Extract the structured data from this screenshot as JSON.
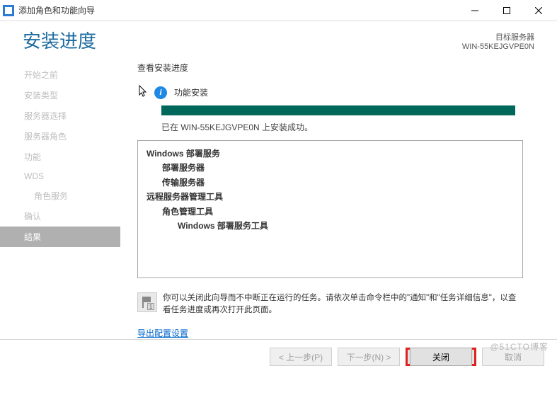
{
  "window": {
    "title": "添加角色和功能向导"
  },
  "header": {
    "title": "安装进度",
    "target_label": "目标服务器",
    "target_server": "WIN-55KEJGVPE0N"
  },
  "sidebar": {
    "items": [
      {
        "label": "开始之前"
      },
      {
        "label": "安装类型"
      },
      {
        "label": "服务器选择"
      },
      {
        "label": "服务器角色"
      },
      {
        "label": "功能"
      },
      {
        "label": "WDS"
      },
      {
        "label": "角色服务",
        "sub": true
      },
      {
        "label": "确认"
      },
      {
        "label": "结果",
        "active": true
      }
    ]
  },
  "progress": {
    "view_label": "查看安装进度",
    "status_title": "功能安装",
    "status_message": "已在 WIN-55KEJGVPE0N 上安装成功。"
  },
  "tree": [
    {
      "text": "Windows 部署服务",
      "bold": true,
      "indent": 0
    },
    {
      "text": "部署服务器",
      "bold": true,
      "indent": 1
    },
    {
      "text": "传输服务器",
      "bold": true,
      "indent": 1
    },
    {
      "text": "远程服务器管理工具",
      "bold": true,
      "indent": 0
    },
    {
      "text": "角色管理工具",
      "bold": true,
      "indent": 1
    },
    {
      "text": "Windows 部署服务工具",
      "bold": true,
      "indent": 2
    }
  ],
  "note": {
    "text": "你可以关闭此向导而不中断正在运行的任务。请依次单击命令栏中的\"通知\"和\"任务详细信息\"，以查看任务进度或再次打开此页面。"
  },
  "links": {
    "export": "导出配置设置"
  },
  "footer": {
    "previous": "< 上一步(P)",
    "next": "下一步(N) >",
    "close": "关闭",
    "cancel": "取消"
  },
  "watermark": "@51CTO博客"
}
